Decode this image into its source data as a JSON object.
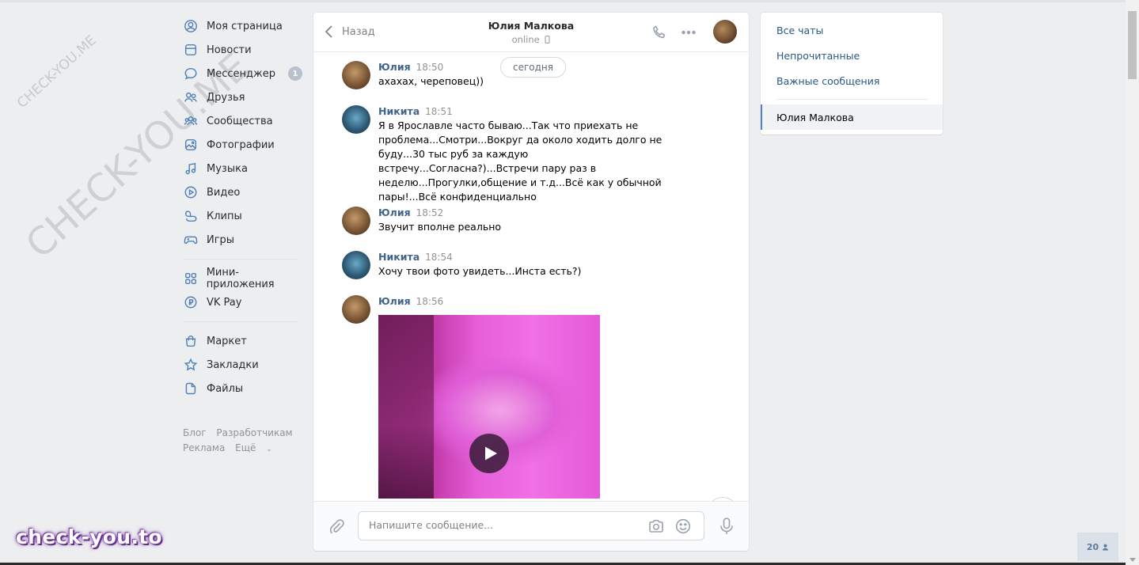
{
  "left_nav": {
    "items": [
      {
        "label": "Моя страница",
        "icon": "user-circle-icon"
      },
      {
        "label": "Новости",
        "icon": "news-icon"
      },
      {
        "label": "Мессенджер",
        "icon": "chat-bubble-icon",
        "badge": "1"
      },
      {
        "label": "Друзья",
        "icon": "friends-icon"
      },
      {
        "label": "Сообщества",
        "icon": "communities-icon"
      },
      {
        "label": "Фотографии",
        "icon": "photos-icon"
      },
      {
        "label": "Музыка",
        "icon": "music-icon"
      },
      {
        "label": "Видео",
        "icon": "video-icon"
      },
      {
        "label": "Клипы",
        "icon": "clips-icon"
      },
      {
        "label": "Игры",
        "icon": "gamepad-icon"
      }
    ],
    "items2": [
      {
        "label": "Мини-приложения",
        "icon": "mini-apps-icon"
      },
      {
        "label": "VK Pay",
        "icon": "vk-pay-icon"
      }
    ],
    "items3": [
      {
        "label": "Маркет",
        "icon": "market-bag-icon"
      },
      {
        "label": "Закладки",
        "icon": "star-icon"
      },
      {
        "label": "Файлы",
        "icon": "file-icon"
      }
    ],
    "footer": {
      "blog": "Блог",
      "dev": "Разработчикам",
      "ads": "Реклама",
      "more": "Ещё"
    }
  },
  "chat": {
    "back_label": "Назад",
    "peer_name": "Юлия Малкова",
    "peer_status": "online",
    "day_label": "сегодня",
    "messages": [
      {
        "author": "Юлия",
        "time": "18:50",
        "text": "ахахах, череповец))"
      },
      {
        "author": "Никита",
        "time": "18:51",
        "text": "Я в Ярославле часто бываю...Так что приехать не проблема...Смотри...Вокруг да около ходить долго не буду...30 тыс руб за каждую встречу...Согласна?)...Встречи пару раз в неделю...Прогулки,общение и т.д...Всё как у обычной пары!...Всё конфиденциально"
      },
      {
        "author": "Юлия",
        "time": "18:52",
        "text": "Звучит вполне реально"
      },
      {
        "author": "Никита",
        "time": "18:54",
        "text": "Хочу твои фото увидеть...Инста есть?)"
      },
      {
        "author": "Юлия",
        "time": "18:56",
        "attachment": "video"
      }
    ],
    "composer": {
      "placeholder": "Напишите сообщение..."
    }
  },
  "folders": {
    "all": "Все чаты",
    "unread": "Непрочитанные",
    "important": "Важные сообщения",
    "active_chat": "Юлия Малкова"
  },
  "online_count": "20",
  "watermarks": {
    "small": "CHECK-YOU.ME",
    "large": "CHECK-YOU.ME",
    "brand": "check-you.to"
  },
  "colors": {
    "accent": "#5181b8",
    "link": "#2a5885",
    "author": "#42648b",
    "bg": "#edeef0"
  }
}
